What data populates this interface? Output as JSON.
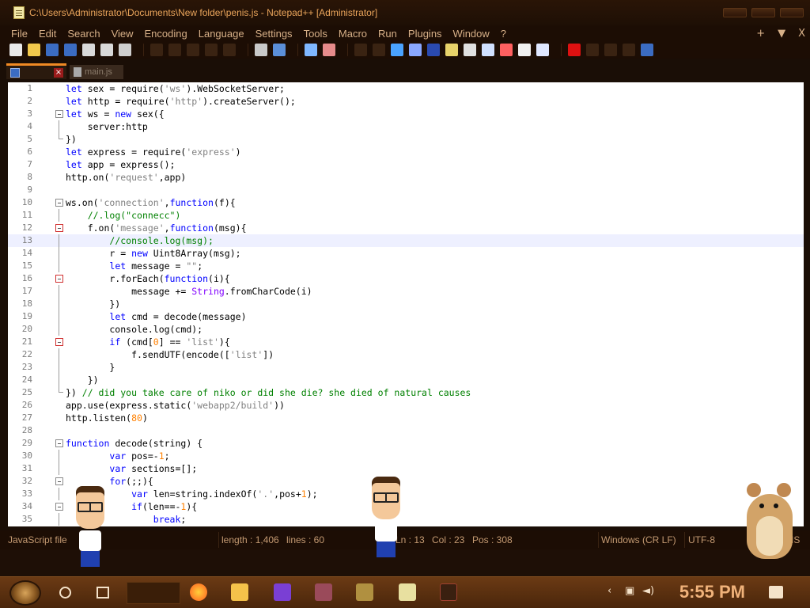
{
  "window": {
    "title": "C:\\Users\\Administrator\\Documents\\New folder\\penis.js - Notepad++ [Administrator]"
  },
  "menu": {
    "items": [
      "File",
      "Edit",
      "Search",
      "View",
      "Encoding",
      "Language",
      "Settings",
      "Tools",
      "Macro",
      "Run",
      "Plugins",
      "Window",
      "?"
    ],
    "right": [
      "+",
      "▼",
      "X"
    ]
  },
  "tabs": {
    "active": "",
    "inactive": "main.js"
  },
  "editor": {
    "current_line": 13,
    "lines": [
      {
        "n": 1,
        "fold": "",
        "html": "<span class=\"kw\">let</span> sex = require(<span class=\"str\">'ws'</span>).WebSocketServer;"
      },
      {
        "n": 2,
        "fold": "",
        "html": "<span class=\"kw\">let</span> http = require(<span class=\"str\">'http'</span>).createServer();"
      },
      {
        "n": 3,
        "fold": "box",
        "html": "<span class=\"kw\">let</span> ws = <span class=\"kw\">new</span> sex({"
      },
      {
        "n": 4,
        "fold": "line",
        "html": "    server:http"
      },
      {
        "n": 5,
        "fold": "end",
        "html": "})"
      },
      {
        "n": 6,
        "fold": "",
        "html": "<span class=\"kw\">let</span> express = require(<span class=\"str\">'express'</span>)"
      },
      {
        "n": 7,
        "fold": "",
        "html": "<span class=\"kw\">let</span> app = express();"
      },
      {
        "n": 8,
        "fold": "",
        "html": "http.on(<span class=\"str\">'request'</span>,app)"
      },
      {
        "n": 9,
        "fold": "",
        "html": ""
      },
      {
        "n": 10,
        "fold": "box",
        "html": "ws.on(<span class=\"str\">'connection'</span>,<span class=\"kw\">function</span>(f){"
      },
      {
        "n": 11,
        "fold": "line",
        "html": "    <span class=\"cmt\">//.log(\"connecc\")</span>"
      },
      {
        "n": 12,
        "fold": "boxred",
        "html": "    f.on(<span class=\"str\">'message'</span>,<span class=\"kw\">function</span>(msg){"
      },
      {
        "n": 13,
        "fold": "line",
        "html": "        <span class=\"cmt\">//console.log(msg);</span>"
      },
      {
        "n": 14,
        "fold": "line",
        "html": "        r = <span class=\"kw\">new</span> Uint8Array(msg);"
      },
      {
        "n": 15,
        "fold": "line",
        "html": "        <span class=\"kw\">let</span> message = <span class=\"dstr\">\"\"</span>;"
      },
      {
        "n": 16,
        "fold": "boxred",
        "html": "        r.forEach(<span class=\"kw\">function</span>(i){"
      },
      {
        "n": 17,
        "fold": "line",
        "html": "            message += <span class=\"bi\">String</span>.fromCharCode(i)"
      },
      {
        "n": 18,
        "fold": "line",
        "html": "        })"
      },
      {
        "n": 19,
        "fold": "line",
        "html": "        <span class=\"kw\">let</span> cmd = decode(message)"
      },
      {
        "n": 20,
        "fold": "line",
        "html": "        console.log(cmd);"
      },
      {
        "n": 21,
        "fold": "boxred",
        "html": "        <span class=\"kw\">if</span> (cmd[<span class=\"num\">0</span>] == <span class=\"str\">'list'</span>){"
      },
      {
        "n": 22,
        "fold": "line",
        "html": "            f.sendUTF(encode([<span class=\"str\">'list'</span>])"
      },
      {
        "n": 23,
        "fold": "line",
        "html": "        }"
      },
      {
        "n": 24,
        "fold": "line",
        "html": "    })"
      },
      {
        "n": 25,
        "fold": "end",
        "html": "}) <span class=\"cmt\">// did you take care of niko or did she die? she died of natural causes</span>"
      },
      {
        "n": 26,
        "fold": "",
        "html": "app.use(express.static(<span class=\"str\">'webapp2/build'</span>))"
      },
      {
        "n": 27,
        "fold": "",
        "html": "http.listen(<span class=\"num\">80</span>)"
      },
      {
        "n": 28,
        "fold": "",
        "html": ""
      },
      {
        "n": 29,
        "fold": "box",
        "html": "<span class=\"kw\">function</span> decode(string) {"
      },
      {
        "n": 30,
        "fold": "line",
        "html": "        <span class=\"kw\">var</span> pos=-<span class=\"num\">1</span>;"
      },
      {
        "n": 31,
        "fold": "line",
        "html": "        <span class=\"kw\">var</span> sections=[];"
      },
      {
        "n": 32,
        "fold": "box",
        "html": "        <span class=\"kw\">for</span>(;;){"
      },
      {
        "n": 33,
        "fold": "line",
        "html": "            <span class=\"kw\">var</span> len=string.indexOf(<span class=\"str\">'.'</span>,pos+<span class=\"num\">1</span>);"
      },
      {
        "n": 34,
        "fold": "box",
        "html": "            <span class=\"kw\">if</span>(len==-<span class=\"num\">1</span>){"
      },
      {
        "n": 35,
        "fold": "line",
        "html": "                <span class=\"kw\">break</span>;"
      }
    ]
  },
  "status": {
    "filetype": "JavaScript file",
    "length": "length : 1,406",
    "lines": "lines : 60",
    "ln": "Ln : 13",
    "col": "Col : 23",
    "pos": "Pos : 308",
    "eol": "Windows (CR LF)",
    "encoding": "UTF-8",
    "mode": "IS"
  },
  "taskbar": {
    "clock": "5:55 PM"
  },
  "colors": {
    "accent_orange": "#f08a24",
    "keyword": "#0000ff",
    "comment": "#008000",
    "string": "#808080",
    "number": "#ff8000"
  }
}
